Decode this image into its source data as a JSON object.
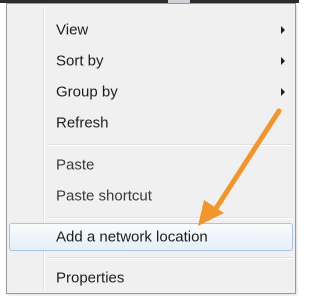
{
  "context_menu": {
    "items": [
      {
        "label": "View",
        "has_submenu": true
      },
      {
        "label": "Sort by",
        "has_submenu": true
      },
      {
        "label": "Group by",
        "has_submenu": true
      },
      {
        "label": "Refresh",
        "has_submenu": false
      },
      {
        "label": "Paste",
        "has_submenu": false
      },
      {
        "label": "Paste shortcut",
        "has_submenu": false
      },
      {
        "label": "Add a network location",
        "has_submenu": false,
        "highlighted": true
      },
      {
        "label": "Properties",
        "has_submenu": false
      }
    ]
  },
  "annotation": {
    "icon": "arrow-icon",
    "color": "#f0962e"
  },
  "colors": {
    "menu_background": "#f0f0f0",
    "highlight_border": "#a8c5e8"
  }
}
